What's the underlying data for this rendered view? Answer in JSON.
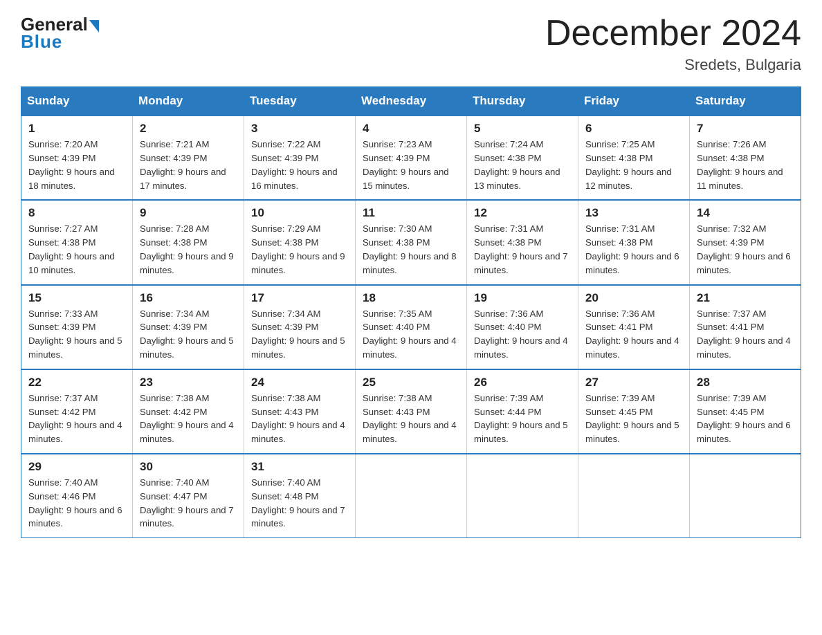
{
  "header": {
    "logo": {
      "general": "General",
      "blue": "Blue"
    },
    "title": "December 2024",
    "location": "Sredets, Bulgaria"
  },
  "weekdays": [
    "Sunday",
    "Monday",
    "Tuesday",
    "Wednesday",
    "Thursday",
    "Friday",
    "Saturday"
  ],
  "weeks": [
    [
      {
        "day": "1",
        "sunrise": "7:20 AM",
        "sunset": "4:39 PM",
        "daylight": "9 hours and 18 minutes."
      },
      {
        "day": "2",
        "sunrise": "7:21 AM",
        "sunset": "4:39 PM",
        "daylight": "9 hours and 17 minutes."
      },
      {
        "day": "3",
        "sunrise": "7:22 AM",
        "sunset": "4:39 PM",
        "daylight": "9 hours and 16 minutes."
      },
      {
        "day": "4",
        "sunrise": "7:23 AM",
        "sunset": "4:39 PM",
        "daylight": "9 hours and 15 minutes."
      },
      {
        "day": "5",
        "sunrise": "7:24 AM",
        "sunset": "4:38 PM",
        "daylight": "9 hours and 13 minutes."
      },
      {
        "day": "6",
        "sunrise": "7:25 AM",
        "sunset": "4:38 PM",
        "daylight": "9 hours and 12 minutes."
      },
      {
        "day": "7",
        "sunrise": "7:26 AM",
        "sunset": "4:38 PM",
        "daylight": "9 hours and 11 minutes."
      }
    ],
    [
      {
        "day": "8",
        "sunrise": "7:27 AM",
        "sunset": "4:38 PM",
        "daylight": "9 hours and 10 minutes."
      },
      {
        "day": "9",
        "sunrise": "7:28 AM",
        "sunset": "4:38 PM",
        "daylight": "9 hours and 9 minutes."
      },
      {
        "day": "10",
        "sunrise": "7:29 AM",
        "sunset": "4:38 PM",
        "daylight": "9 hours and 9 minutes."
      },
      {
        "day": "11",
        "sunrise": "7:30 AM",
        "sunset": "4:38 PM",
        "daylight": "9 hours and 8 minutes."
      },
      {
        "day": "12",
        "sunrise": "7:31 AM",
        "sunset": "4:38 PM",
        "daylight": "9 hours and 7 minutes."
      },
      {
        "day": "13",
        "sunrise": "7:31 AM",
        "sunset": "4:38 PM",
        "daylight": "9 hours and 6 minutes."
      },
      {
        "day": "14",
        "sunrise": "7:32 AM",
        "sunset": "4:39 PM",
        "daylight": "9 hours and 6 minutes."
      }
    ],
    [
      {
        "day": "15",
        "sunrise": "7:33 AM",
        "sunset": "4:39 PM",
        "daylight": "9 hours and 5 minutes."
      },
      {
        "day": "16",
        "sunrise": "7:34 AM",
        "sunset": "4:39 PM",
        "daylight": "9 hours and 5 minutes."
      },
      {
        "day": "17",
        "sunrise": "7:34 AM",
        "sunset": "4:39 PM",
        "daylight": "9 hours and 5 minutes."
      },
      {
        "day": "18",
        "sunrise": "7:35 AM",
        "sunset": "4:40 PM",
        "daylight": "9 hours and 4 minutes."
      },
      {
        "day": "19",
        "sunrise": "7:36 AM",
        "sunset": "4:40 PM",
        "daylight": "9 hours and 4 minutes."
      },
      {
        "day": "20",
        "sunrise": "7:36 AM",
        "sunset": "4:41 PM",
        "daylight": "9 hours and 4 minutes."
      },
      {
        "day": "21",
        "sunrise": "7:37 AM",
        "sunset": "4:41 PM",
        "daylight": "9 hours and 4 minutes."
      }
    ],
    [
      {
        "day": "22",
        "sunrise": "7:37 AM",
        "sunset": "4:42 PM",
        "daylight": "9 hours and 4 minutes."
      },
      {
        "day": "23",
        "sunrise": "7:38 AM",
        "sunset": "4:42 PM",
        "daylight": "9 hours and 4 minutes."
      },
      {
        "day": "24",
        "sunrise": "7:38 AM",
        "sunset": "4:43 PM",
        "daylight": "9 hours and 4 minutes."
      },
      {
        "day": "25",
        "sunrise": "7:38 AM",
        "sunset": "4:43 PM",
        "daylight": "9 hours and 4 minutes."
      },
      {
        "day": "26",
        "sunrise": "7:39 AM",
        "sunset": "4:44 PM",
        "daylight": "9 hours and 5 minutes."
      },
      {
        "day": "27",
        "sunrise": "7:39 AM",
        "sunset": "4:45 PM",
        "daylight": "9 hours and 5 minutes."
      },
      {
        "day": "28",
        "sunrise": "7:39 AM",
        "sunset": "4:45 PM",
        "daylight": "9 hours and 6 minutes."
      }
    ],
    [
      {
        "day": "29",
        "sunrise": "7:40 AM",
        "sunset": "4:46 PM",
        "daylight": "9 hours and 6 minutes."
      },
      {
        "day": "30",
        "sunrise": "7:40 AM",
        "sunset": "4:47 PM",
        "daylight": "9 hours and 7 minutes."
      },
      {
        "day": "31",
        "sunrise": "7:40 AM",
        "sunset": "4:48 PM",
        "daylight": "9 hours and 7 minutes."
      },
      null,
      null,
      null,
      null
    ]
  ]
}
